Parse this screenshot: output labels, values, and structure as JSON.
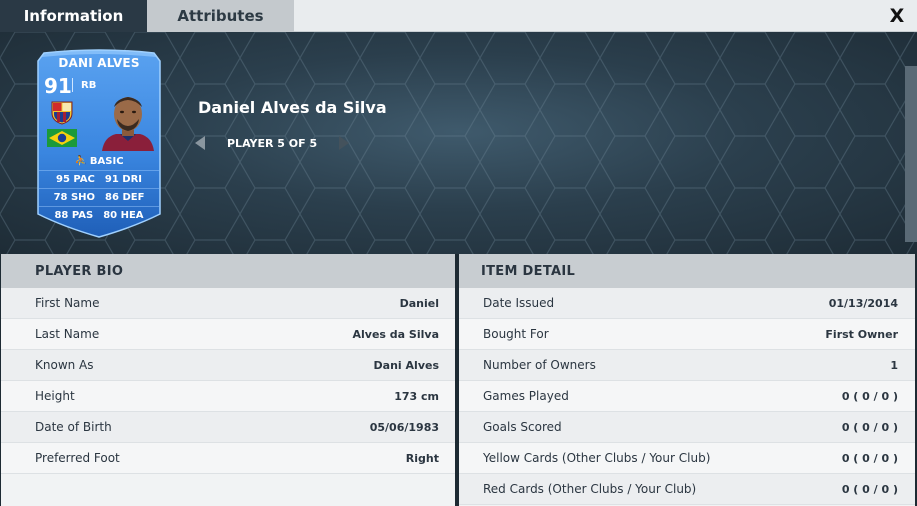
{
  "tabs": [
    {
      "label": "Information"
    },
    {
      "label": "Attributes"
    }
  ],
  "close_label": "X",
  "card": {
    "name": "DANI ALVES",
    "rating": "91",
    "position": "RB",
    "style": "BASIC",
    "colors": {
      "card_top": "#5aa2f0",
      "card_bottom": "#1f5fb8",
      "flag_green": "#1b9a3a",
      "flag_yellow": "#f6d10f",
      "flag_blue": "#1c3f94"
    },
    "stats": [
      [
        "95 PAC",
        "91 DRI"
      ],
      [
        "78 SHO",
        "86 DEF"
      ],
      [
        "88 PAS",
        "80 HEA"
      ]
    ]
  },
  "player": {
    "full_name": "Daniel Alves da Silva",
    "pager": "PLAYER 5 OF 5"
  },
  "player_bio": {
    "title": "PLAYER BIO",
    "rows": [
      {
        "label": "First Name",
        "value": "Daniel"
      },
      {
        "label": "Last Name",
        "value": "Alves da Silva"
      },
      {
        "label": "Known As",
        "value": "Dani Alves"
      },
      {
        "label": "Height",
        "value": "173 cm"
      },
      {
        "label": "Date of Birth",
        "value": "05/06/1983"
      },
      {
        "label": "Preferred Foot",
        "value": "Right"
      }
    ]
  },
  "item_detail": {
    "title": "ITEM DETAIL",
    "rows": [
      {
        "label": "Date Issued",
        "value": "01/13/2014"
      },
      {
        "label": "Bought For",
        "value": "First Owner"
      },
      {
        "label": "Number of Owners",
        "value": "1"
      },
      {
        "label": "Games Played",
        "value": "0 ( 0 / 0 )"
      },
      {
        "label": "Goals Scored",
        "value": "0 ( 0 / 0 )"
      },
      {
        "label": "Yellow Cards (Other Clubs / Your Club)",
        "value": "0 ( 0 / 0 )"
      },
      {
        "label": "Red Cards (Other Clubs / Your Club)",
        "value": "0 ( 0 / 0 )"
      }
    ]
  }
}
